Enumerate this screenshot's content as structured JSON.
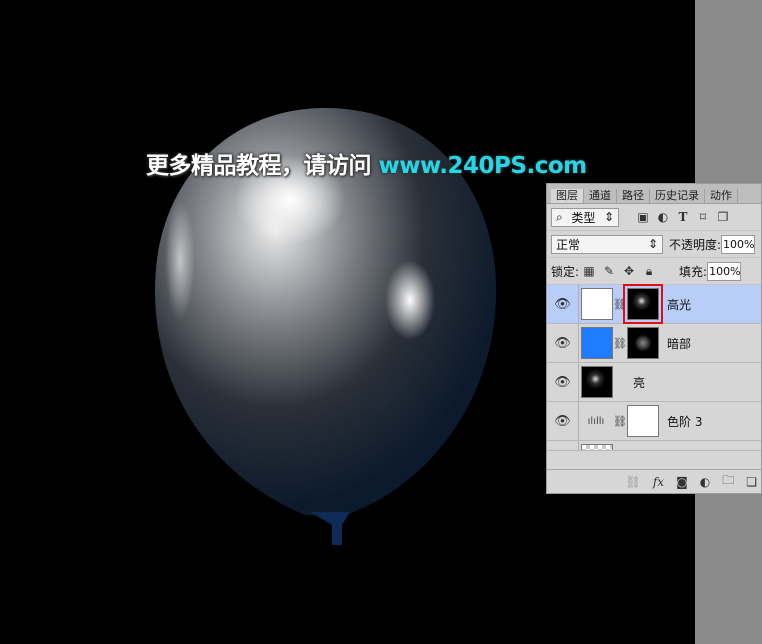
{
  "watermark": {
    "cn": "更多精品教程，请访问",
    "url": "www.240PS.com"
  },
  "panel": {
    "tabs": [
      "图层",
      "通道",
      "路径",
      "历史记录",
      "动作"
    ],
    "filter": {
      "label": "类型"
    },
    "blend_mode": "正常",
    "opacity_label": "不透明度:",
    "opacity": "100%",
    "lock_label": "锁定:",
    "fill_label": "填充:",
    "fill": "100%",
    "layers": [
      {
        "name": "高光",
        "thumb": "#ffffff",
        "mask": "highlight",
        "active": true
      },
      {
        "name": "暗部",
        "thumb": "#1f7bff",
        "mask": "shadow",
        "active": false
      },
      {
        "name": "亮",
        "thumb": "#000000",
        "mask": "",
        "active": false
      },
      {
        "name": "色阶 3",
        "thumb": "levels",
        "mask": "#ffffff",
        "active": false
      }
    ]
  },
  "colors": {
    "selection": "#b8cdf7",
    "mask_highlight_border": "#e01010",
    "url": "#25d6e8"
  }
}
